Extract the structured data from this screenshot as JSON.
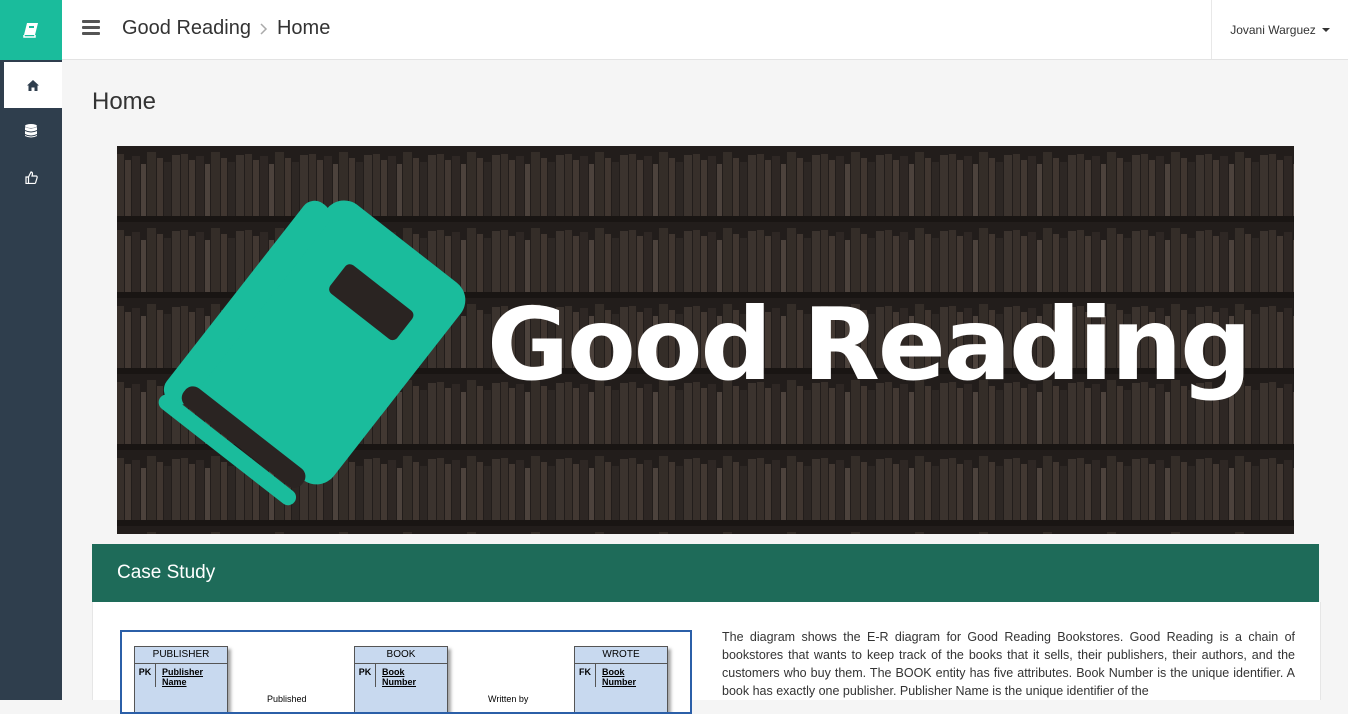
{
  "app": {
    "name": "Good Reading"
  },
  "breadcrumb": {
    "app": "Good Reading",
    "page": "Home"
  },
  "user": {
    "name": "Jovani Warguez"
  },
  "sidebar": {
    "items": [
      {
        "icon": "home-icon",
        "active": true
      },
      {
        "icon": "database-icon",
        "active": false
      },
      {
        "icon": "thumbs-up-icon",
        "active": false
      }
    ]
  },
  "page": {
    "title": "Home"
  },
  "banner": {
    "text": "Good Reading"
  },
  "case_study": {
    "title": "Case Study",
    "diagram": {
      "entities": [
        {
          "name": "PUBLISHER",
          "key": "PK",
          "attr_1": "Publisher",
          "attr_2": "Name"
        },
        {
          "name": "BOOK",
          "key": "PK",
          "attr_1": "Book",
          "attr_2": "Number"
        },
        {
          "name": "WROTE",
          "key": "FK",
          "attr_1": "Book",
          "attr_2": "Number"
        }
      ],
      "relationships": [
        "Published",
        "Written by"
      ]
    },
    "text": "The diagram shows the E-R diagram for Good Reading Bookstores. Good Reading is a chain of bookstores that wants to keep track of the books that it sells, their publishers, their authors, and the customers who buy them. The BOOK entity has five attributes. Book Number is the unique identifier. A book has exactly one publisher. Publisher Name is the unique identifier of the"
  },
  "colors": {
    "accent": "#1abc9c",
    "sidebar": "#2f3e4d",
    "case_header": "#1e6b59"
  }
}
